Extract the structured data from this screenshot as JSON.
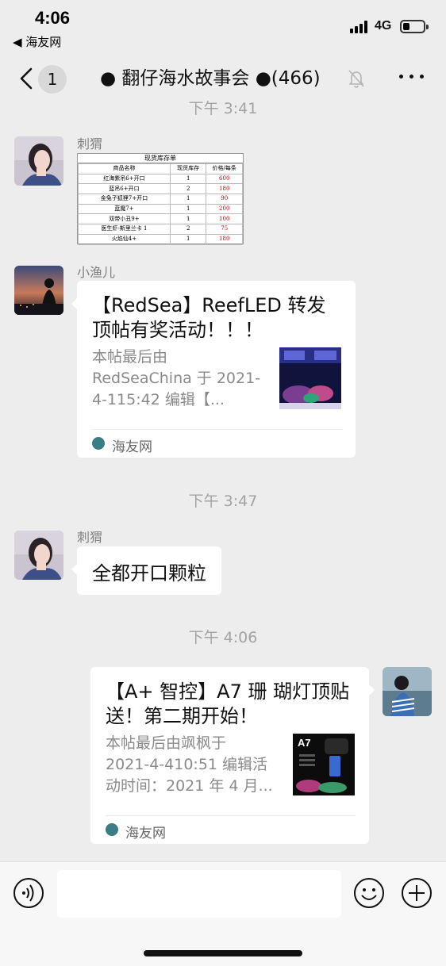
{
  "status_bar": {
    "time": "4:06",
    "back_app": "◀ 海友网",
    "network": "4G",
    "battery_level": 0.35
  },
  "nav": {
    "unread_count": "1",
    "title": "● 翻仔海水故事会 ●(466)",
    "back_icon": "chevron-left-icon",
    "mute_icon": "bell-muted-icon",
    "more_icon": "more-dots-icon"
  },
  "timestamps": [
    "下午 3:41",
    "下午 3:47",
    "下午 4:06"
  ],
  "messages": [
    {
      "sender": "刺猬",
      "type": "image",
      "image": {
        "title": "现货库存单",
        "headers": [
          "商品名称",
          "现货库存",
          "价格/每条"
        ],
        "rows": [
          [
            "红海紫吊6+开口",
            "1",
            "600"
          ],
          [
            "蓝吊6+开口",
            "2",
            "180"
          ],
          [
            "金兔子狐狸7+开口",
            "1",
            "90"
          ],
          [
            "蓝魔7+",
            "1",
            "200"
          ],
          [
            "双带小丑9+",
            "1",
            "100"
          ],
          [
            "医生虾-斯里兰卡 1",
            "2",
            "75"
          ],
          [
            "火焰仙4+",
            "1",
            "180"
          ]
        ]
      }
    },
    {
      "sender": "小渔儿",
      "type": "link",
      "title_lines": [
        "【RedSea】ReefLED 转发",
        "顶帖有奖活动！！！"
      ],
      "desc_lines": [
        "本帖最后由",
        "RedSeaChina 于 2021-",
        "4-115:42 编辑【..."
      ],
      "source": "海友网"
    },
    {
      "sender": "刺猬",
      "type": "text",
      "text": "全都开口颗粒"
    },
    {
      "sender": "me",
      "type": "link",
      "title_lines": [
        "【A+ 智控】A7 珊 瑚灯顶贴",
        "送！第二期开始！"
      ],
      "desc_lines": [
        "本帖最后由飒枫于",
        "2021-4-410:51 编辑活",
        "动时间：2021 年 4 月..."
      ],
      "thumb_label": "A7",
      "source": "海友网"
    }
  ],
  "input_bar": {
    "voice_icon": "voice-icon",
    "emoji_icon": "emoji-icon",
    "plus_icon": "plus-icon",
    "value": ""
  },
  "colors": {
    "background": "#ededed",
    "bubble": "#ffffff",
    "timestamp": "#a3a3a3",
    "price_red": "#cc0000"
  }
}
